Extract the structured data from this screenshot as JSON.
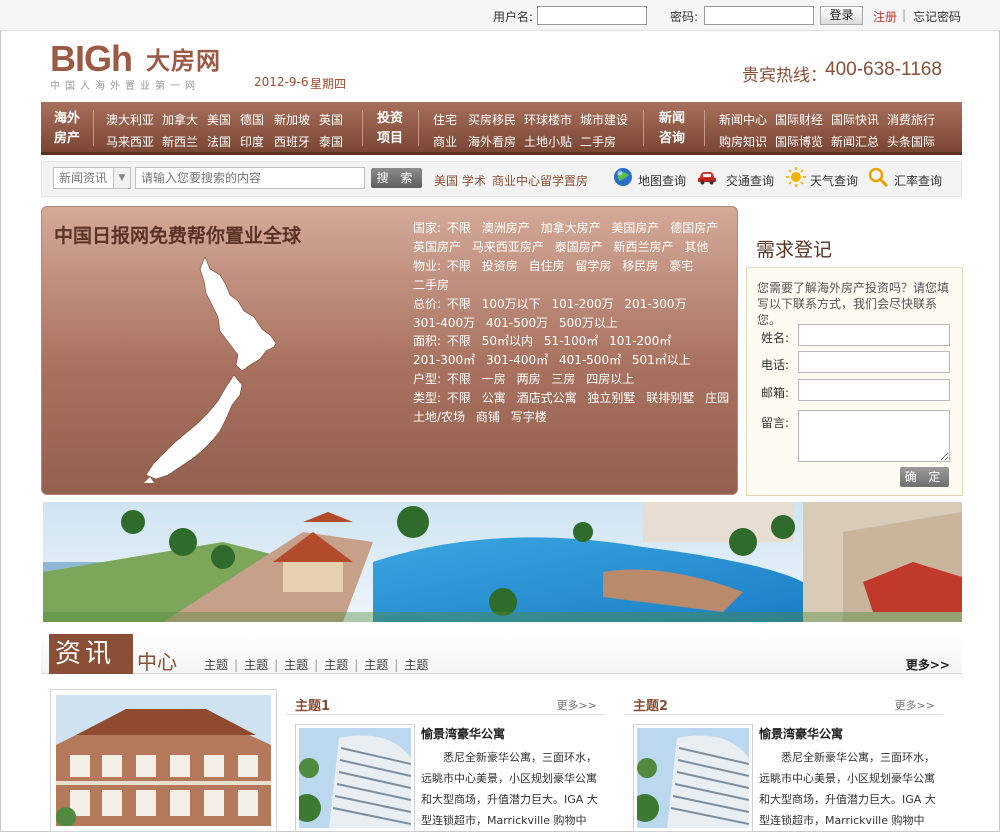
{
  "topbar": {
    "username_label": "用户名:",
    "password_label": "密码:",
    "login_button": "登录",
    "register_link": "注册",
    "separator": "|",
    "forgot_link": "忘记密码"
  },
  "header": {
    "logo_text": "BIGh",
    "logo_cn": "大房网",
    "logo_sub": "中国人海外置业第一网",
    "date": "2012-9-6",
    "weekday": "星期四",
    "hotline_label": "贵宾热线：",
    "hotline_number": "400-638-1168"
  },
  "nav": {
    "groups": [
      {
        "title_line1": "海外",
        "title_line2": "房产",
        "row1": [
          "澳大利亚",
          "加拿大",
          "美国",
          "德国",
          "新加坡",
          "英国"
        ],
        "row2": [
          "马来西亚",
          "新西兰",
          "法国",
          "印度",
          "西班牙",
          "泰国"
        ]
      },
      {
        "title_line1": "投资",
        "title_line2": "项目",
        "row1": [
          "住宅",
          "买房移民",
          "环球楼市",
          "城市建设"
        ],
        "row2": [
          "商业",
          "海外看房",
          "土地小贴",
          "二手房"
        ]
      },
      {
        "title_line1": "新闻",
        "title_line2": "咨询",
        "row1": [
          "新闻中心",
          "国际财经",
          "国际快讯",
          "消费旅行"
        ],
        "row2": [
          "购房知识",
          "国际博览",
          "新闻汇总",
          "头条国际"
        ]
      }
    ]
  },
  "search": {
    "category": "新闻资讯",
    "placeholder": "请输入您要搜索的内容",
    "button": "搜 索",
    "quick_links": [
      "美国",
      "学术",
      "商业中心",
      "留学置房"
    ],
    "tools": [
      {
        "label": "地图查询",
        "icon": "globe-icon"
      },
      {
        "label": "交通查询",
        "icon": "car-icon"
      },
      {
        "label": "天气查询",
        "icon": "sun-icon"
      },
      {
        "label": "汇率查询",
        "icon": "magnifier-icon"
      }
    ]
  },
  "panel": {
    "title": "中国日报网免费帮你置业全球",
    "country_label": "国家:",
    "countries": [
      "不限",
      "澳洲房产",
      "加拿大房产",
      "美国房产",
      "德国房产",
      "英国房产",
      "马来西亚房产",
      "泰国房产",
      "新西兰房产",
      "其他"
    ],
    "property_label": "物业:",
    "properties": [
      "不限",
      "投资房",
      "自住房",
      "留学房",
      "移民房",
      "豪宅",
      "二手房"
    ],
    "price_label": "总价:",
    "prices": [
      "不限",
      "100万以下",
      "101-200万",
      "201-300万",
      "301-400万",
      "401-500万",
      "500万以上"
    ],
    "area_label": "面积:",
    "areas": [
      "不限",
      "50㎡以内",
      "51-100㎡",
      "101-200㎡",
      "201-300㎡",
      "301-400㎡",
      "401-500㎡",
      "501㎡以上"
    ],
    "room_label": "户型:",
    "rooms": [
      "不限",
      "一房",
      "两房",
      "三房",
      "四房以上"
    ],
    "type_label": "类型:",
    "types": [
      "不限",
      "公寓",
      "酒店式公寓",
      "独立别墅",
      "联排别墅",
      "庄园",
      "土地/农场",
      "商铺",
      "写字楼"
    ]
  },
  "signup": {
    "title": "需求登记",
    "description": "您需要了解海外房产投资吗？请您填写以下联系方式，我们会尽快联系您。",
    "fields": [
      "姓名:",
      "电话:",
      "邮箱:",
      "留言:"
    ],
    "submit": "确 定"
  },
  "info": {
    "title_main": "资讯",
    "title_sub": "中心",
    "topics": [
      "主题",
      "主题",
      "主题",
      "主题",
      "主题",
      "主题"
    ],
    "more": "更多>>",
    "columns": [
      {
        "title": "主题1",
        "more": "更多>>",
        "article_title": "愉景湾豪华公寓",
        "article_body": "悉尼全新豪华公寓，三面环水，远眺市中心美景，小区规划豪华公寓和大型商场，升值潜力巨大。IGA 大型连锁超市，Marrickville 购物中"
      },
      {
        "title": "主题2",
        "more": "更多>>",
        "article_title": "愉景湾豪华公寓",
        "article_body": "悉尼全新豪华公寓，三面环水，远眺市中心美景，小区规划豪华公寓和大型商场，升值潜力巨大。IGA 大型连锁超市，Marrickville 购物中"
      }
    ]
  },
  "colors": {
    "brand_brown": "#8a4f36",
    "nav_top": "#a8705c",
    "nav_bottom": "#7a4634",
    "accent_red": "#c0392b"
  }
}
